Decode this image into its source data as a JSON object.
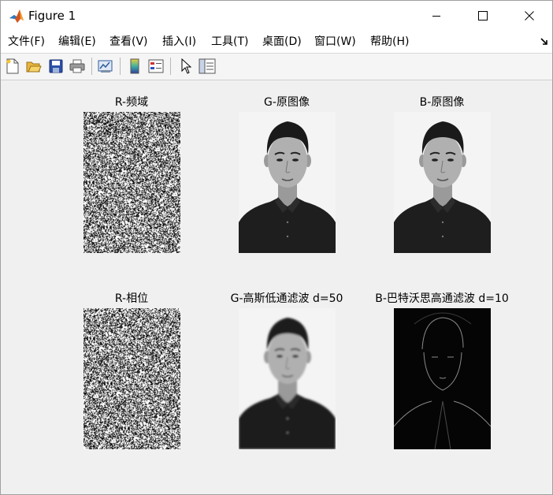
{
  "window": {
    "title": "Figure 1",
    "controls": [
      "minimize",
      "maximize",
      "close"
    ]
  },
  "menu": [
    "文件(F)",
    "编辑(E)",
    "查看(V)",
    "插入(I)",
    "工具(T)",
    "桌面(D)",
    "窗口(W)",
    "帮助(H)"
  ],
  "toolbar": [
    "new-figure-icon",
    "open-file-icon",
    "save-icon",
    "print-icon",
    "link-plot-icon",
    "colorbar-icon",
    "legend-icon",
    "pointer-icon",
    "property-editor-icon"
  ],
  "subplots": [
    {
      "title": "R-频域",
      "kind": "noise"
    },
    {
      "title": "G-原图像",
      "kind": "portrait"
    },
    {
      "title": "B-原图像",
      "kind": "portrait"
    },
    {
      "title": "R-相位",
      "kind": "noise"
    },
    {
      "title": "G-高斯低通滤波 d=50",
      "kind": "portrait-blur"
    },
    {
      "title": "B-巴特沃思高通滤波 d=10",
      "kind": "edges"
    }
  ]
}
